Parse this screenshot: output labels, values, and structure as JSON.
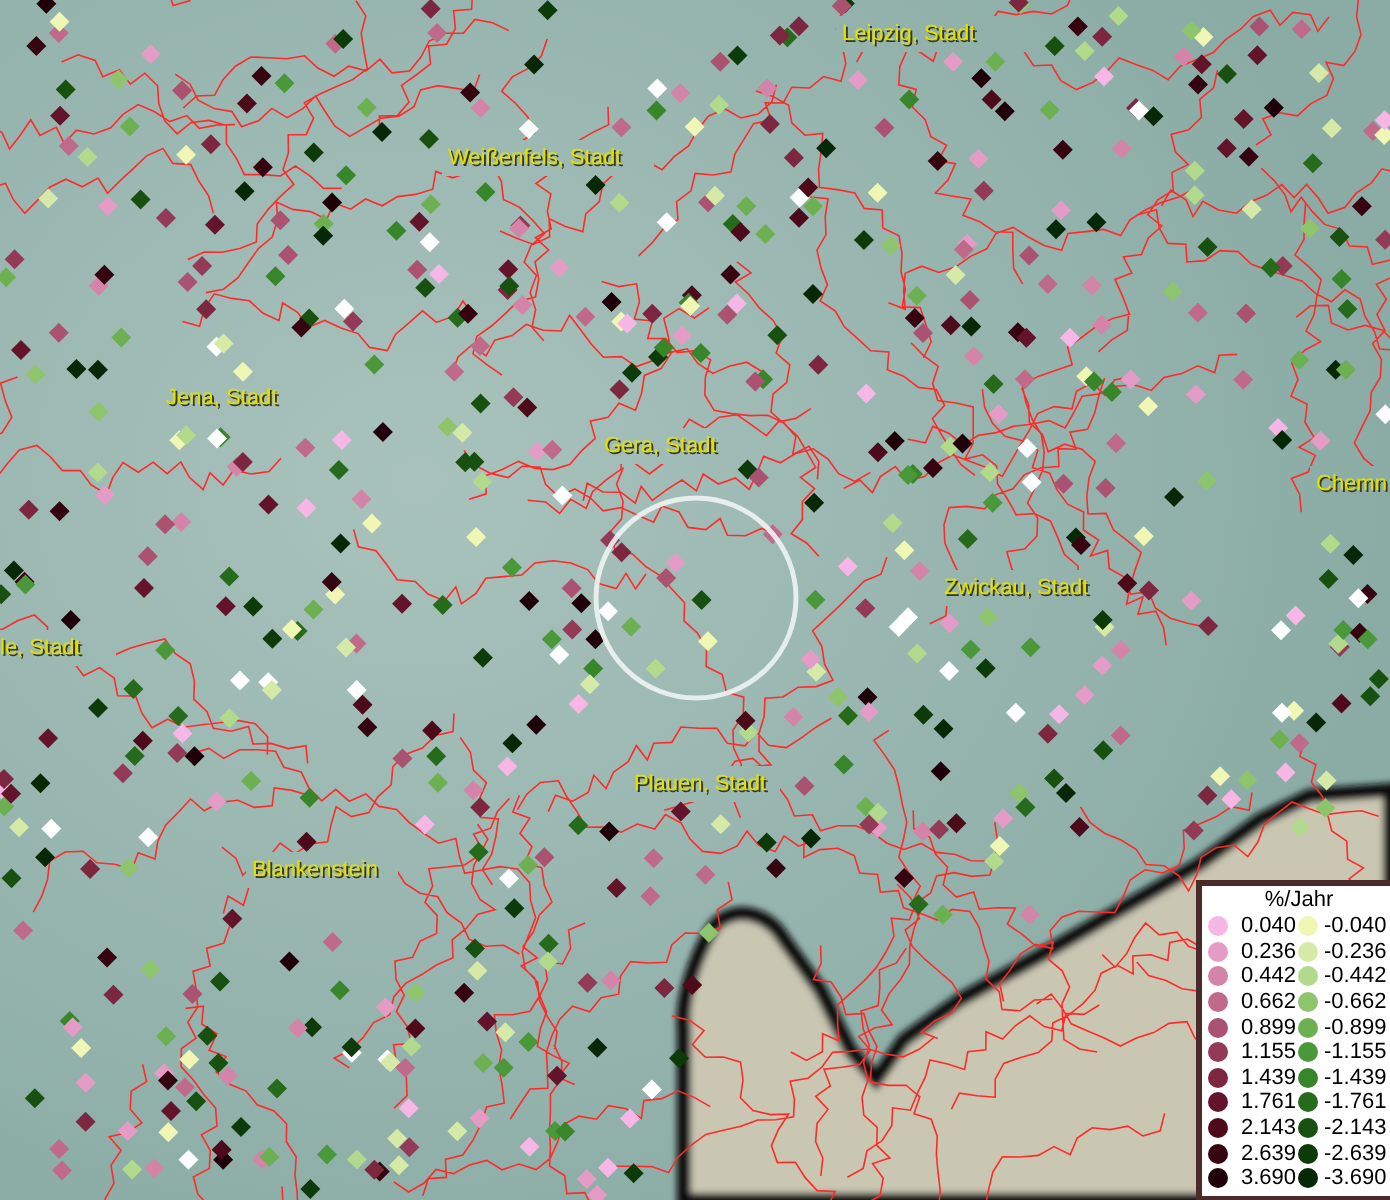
{
  "map": {
    "place_labels": [
      {
        "text": "Leipzig, Stadt"
      },
      {
        "text": "Weißenfels, Stadt"
      },
      {
        "text": "Jena, Stadt"
      },
      {
        "text": "Gera, Stadt"
      },
      {
        "text": "Chemn"
      },
      {
        "text": "Zwickau, Stadt"
      },
      {
        "text": "le, Stadt"
      },
      {
        "text": "Plauen, Stadt"
      },
      {
        "text": "Blankenstein"
      }
    ]
  },
  "legend": {
    "title": "%/Jahr",
    "positive": [
      {
        "value": "0.040",
        "color": "#f6b6e6"
      },
      {
        "value": "0.236",
        "color": "#e49cc6"
      },
      {
        "value": "0.442",
        "color": "#d484a8"
      },
      {
        "value": "0.662",
        "color": "#c06a8a"
      },
      {
        "value": "0.899",
        "color": "#aa5270"
      },
      {
        "value": "1.155",
        "color": "#923a56"
      },
      {
        "value": "1.439",
        "color": "#7c2640"
      },
      {
        "value": "1.761",
        "color": "#64142a"
      },
      {
        "value": "2.143",
        "color": "#4c0a1a"
      },
      {
        "value": "2.639",
        "color": "#360410"
      },
      {
        "value": "3.690",
        "color": "#200008"
      }
    ],
    "negative": [
      {
        "value": "-0.040",
        "color": "#f0f6b4"
      },
      {
        "value": "-0.236",
        "color": "#d6eaa8"
      },
      {
        "value": "-0.442",
        "color": "#b2da8c"
      },
      {
        "value": "-0.662",
        "color": "#8ec46c"
      },
      {
        "value": "-0.899",
        "color": "#6cb052"
      },
      {
        "value": "-1.155",
        "color": "#4a983a"
      },
      {
        "value": "-1.439",
        "color": "#38862a"
      },
      {
        "value": "-1.761",
        "color": "#266a1c"
      },
      {
        "value": "-2.143",
        "color": "#185010"
      },
      {
        "value": "-2.639",
        "color": "#0c3a08"
      },
      {
        "value": "-3.690",
        "color": "#062806"
      }
    ]
  }
}
